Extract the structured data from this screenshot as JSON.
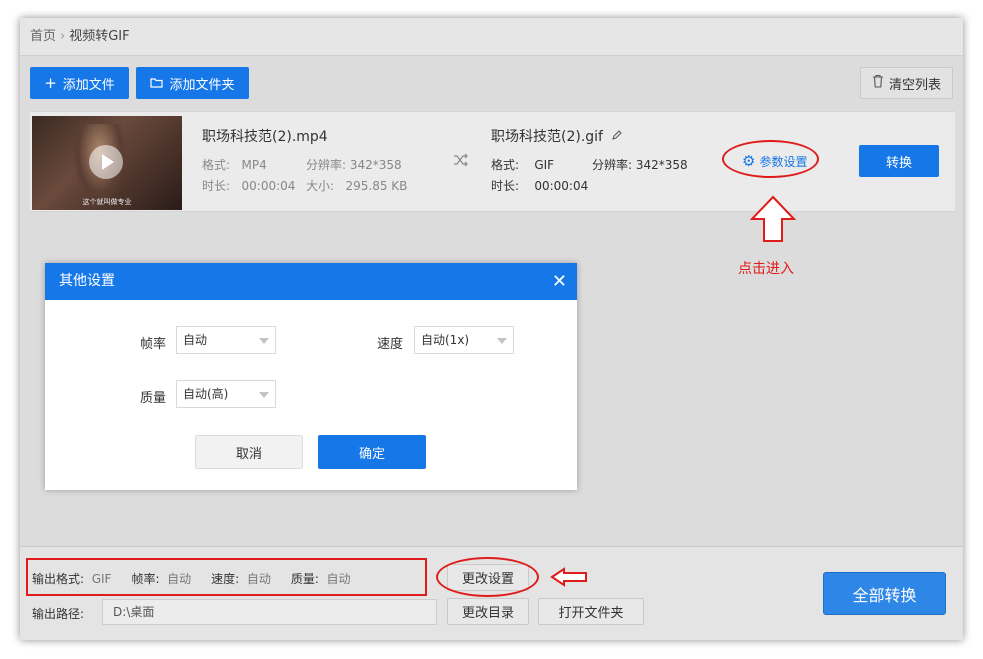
{
  "breadcrumb": {
    "home": "首页",
    "separator": "›",
    "current": "视频转GIF"
  },
  "toolbar": {
    "add_file": "添加文件",
    "add_folder": "添加文件夹",
    "clear_list": "清空列表",
    "add_icon": "plus-icon",
    "folder_icon": "folder-icon",
    "trash_icon": "trash-icon"
  },
  "file_item": {
    "thumbnail_caption": "这个就叫做专业",
    "source": {
      "name": "职场科技范(2).mp4",
      "format_label": "格式:",
      "format": "MP4",
      "resolution_label": "分辨率:",
      "resolution": "342*358",
      "duration_label": "时长:",
      "duration": "00:00:04",
      "size_label": "大小:",
      "size": "295.85 KB"
    },
    "output": {
      "name": "职场科技范(2).gif",
      "format_label": "格式:",
      "format": "GIF",
      "resolution_label": "分辨率:",
      "resolution": "342*358",
      "duration_label": "时长:",
      "duration": "00:00:04"
    },
    "param_settings": "参数设置",
    "convert": "转换"
  },
  "annotation": {
    "hint": "点击进入",
    "color": "#e01b1b"
  },
  "dialog": {
    "title": "其他设置",
    "close": "✕",
    "frame_rate_label": "帧率",
    "frame_rate_value": "自动",
    "speed_label": "速度",
    "speed_value": "自动(1x)",
    "quality_label": "质量",
    "quality_value": "自动(高)",
    "cancel": "取消",
    "ok": "确定"
  },
  "bottom": {
    "output_format_label": "输出格式:",
    "output_format": "GIF",
    "frame_rate_label": "帧率:",
    "frame_rate": "自动",
    "speed_label": "速度:",
    "speed": "自动",
    "quality_label": "质量:",
    "quality": "自动",
    "change_settings": "更改设置",
    "output_path_label": "输出路径:",
    "output_path": "D:\\桌面",
    "change_dir": "更改目录",
    "open_folder": "打开文件夹",
    "convert_all": "全部转换"
  },
  "colors": {
    "accent": "#1677e8",
    "annotation_red": "#e01b1b"
  }
}
